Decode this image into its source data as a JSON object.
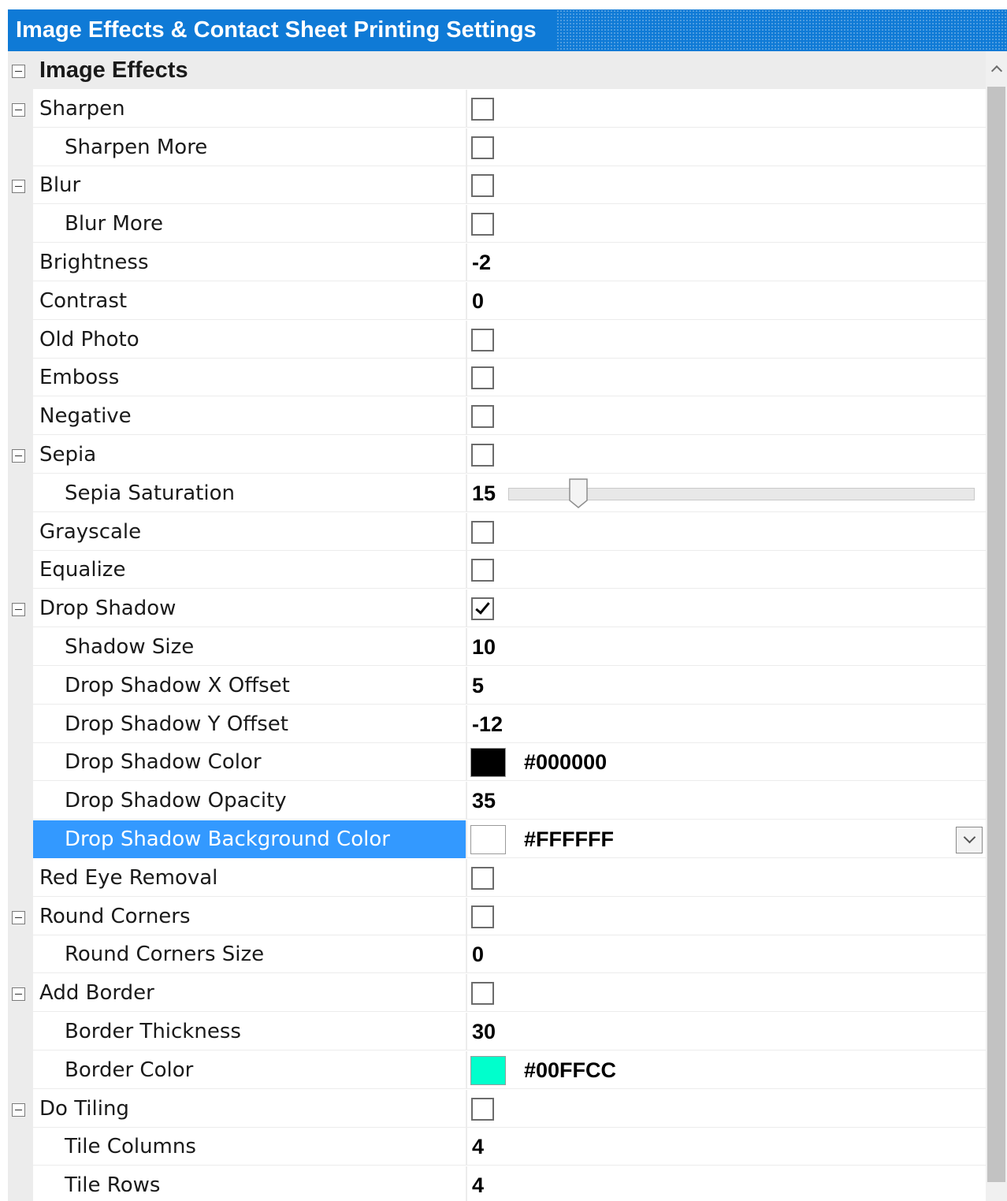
{
  "window": {
    "title": "Image Effects & Contact Sheet Printing Settings",
    "title_color": "#0F7AD6"
  },
  "category": {
    "label": "Image Effects",
    "expanded": true
  },
  "rows": [
    {
      "id": "sharpen",
      "label": "Sharpen",
      "level": 0,
      "expander": true,
      "type": "checkbox",
      "checked": false
    },
    {
      "id": "sharpen-more",
      "label": "Sharpen More",
      "level": 1,
      "expander": false,
      "type": "checkbox",
      "checked": false
    },
    {
      "id": "blur",
      "label": "Blur",
      "level": 0,
      "expander": true,
      "type": "checkbox",
      "checked": false
    },
    {
      "id": "blur-more",
      "label": "Blur More",
      "level": 1,
      "expander": false,
      "type": "checkbox",
      "checked": false
    },
    {
      "id": "brightness",
      "label": "Brightness",
      "level": 0,
      "expander": false,
      "type": "number",
      "value": "-2"
    },
    {
      "id": "contrast",
      "label": "Contrast",
      "level": 0,
      "expander": false,
      "type": "number",
      "value": "0"
    },
    {
      "id": "old-photo",
      "label": "Old Photo",
      "level": 0,
      "expander": false,
      "type": "checkbox",
      "checked": false
    },
    {
      "id": "emboss",
      "label": "Emboss",
      "level": 0,
      "expander": false,
      "type": "checkbox",
      "checked": false
    },
    {
      "id": "negative",
      "label": "Negative",
      "level": 0,
      "expander": false,
      "type": "checkbox",
      "checked": false
    },
    {
      "id": "sepia",
      "label": "Sepia",
      "level": 0,
      "expander": true,
      "type": "checkbox",
      "checked": false
    },
    {
      "id": "sepia-saturation",
      "label": "Sepia Saturation",
      "level": 1,
      "expander": false,
      "type": "slider",
      "value": "15",
      "slider_fraction": 0.15
    },
    {
      "id": "grayscale",
      "label": "Grayscale",
      "level": 0,
      "expander": false,
      "type": "checkbox",
      "checked": false
    },
    {
      "id": "equalize",
      "label": "Equalize",
      "level": 0,
      "expander": false,
      "type": "checkbox",
      "checked": false
    },
    {
      "id": "drop-shadow",
      "label": "Drop Shadow",
      "level": 0,
      "expander": true,
      "type": "checkbox",
      "checked": true
    },
    {
      "id": "shadow-size",
      "label": "Shadow Size",
      "level": 1,
      "expander": false,
      "type": "number",
      "value": "10"
    },
    {
      "id": "drop-shadow-x-offset",
      "label": "Drop Shadow X Offset",
      "level": 1,
      "expander": false,
      "type": "number",
      "value": "5"
    },
    {
      "id": "drop-shadow-y-offset",
      "label": "Drop Shadow Y Offset",
      "level": 1,
      "expander": false,
      "type": "number",
      "value": "-12"
    },
    {
      "id": "drop-shadow-color",
      "label": "Drop Shadow Color",
      "level": 1,
      "expander": false,
      "type": "color",
      "value": "#000000",
      "swatch": "#000000"
    },
    {
      "id": "drop-shadow-opacity",
      "label": "Drop Shadow Opacity",
      "level": 1,
      "expander": false,
      "type": "number",
      "value": "35"
    },
    {
      "id": "drop-shadow-background-color",
      "label": "Drop Shadow Background Color",
      "level": 1,
      "expander": false,
      "type": "color",
      "value": "#FFFFFF",
      "swatch": "#FFFFFF",
      "selected": true,
      "dropdown": true
    },
    {
      "id": "red-eye-removal",
      "label": "Red Eye Removal",
      "level": 0,
      "expander": false,
      "type": "checkbox",
      "checked": false
    },
    {
      "id": "round-corners",
      "label": "Round Corners",
      "level": 0,
      "expander": true,
      "type": "checkbox",
      "checked": false
    },
    {
      "id": "round-corners-size",
      "label": "Round Corners Size",
      "level": 1,
      "expander": false,
      "type": "number",
      "value": "0"
    },
    {
      "id": "add-border",
      "label": "Add Border",
      "level": 0,
      "expander": true,
      "type": "checkbox",
      "checked": false
    },
    {
      "id": "border-thickness",
      "label": "Border Thickness",
      "level": 1,
      "expander": false,
      "type": "number",
      "value": "30"
    },
    {
      "id": "border-color",
      "label": "Border Color",
      "level": 1,
      "expander": false,
      "type": "color",
      "value": "#00FFCC",
      "swatch": "#00FFCC"
    },
    {
      "id": "do-tiling",
      "label": "Do Tiling",
      "level": 0,
      "expander": true,
      "type": "checkbox",
      "checked": false
    },
    {
      "id": "tile-columns",
      "label": "Tile Columns",
      "level": 1,
      "expander": false,
      "type": "number",
      "value": "4"
    },
    {
      "id": "tile-rows",
      "label": "Tile Rows",
      "level": 1,
      "expander": false,
      "type": "number",
      "value": "4"
    }
  ],
  "colors": {
    "selection": "#3399FF",
    "gutter": "#ECECEC"
  },
  "icons": {
    "expander": "collapse-minus-icon",
    "checkbox_checked": "checkmark-icon",
    "dropdown": "chevron-down-icon",
    "scroll_up": "chevron-up-icon"
  }
}
